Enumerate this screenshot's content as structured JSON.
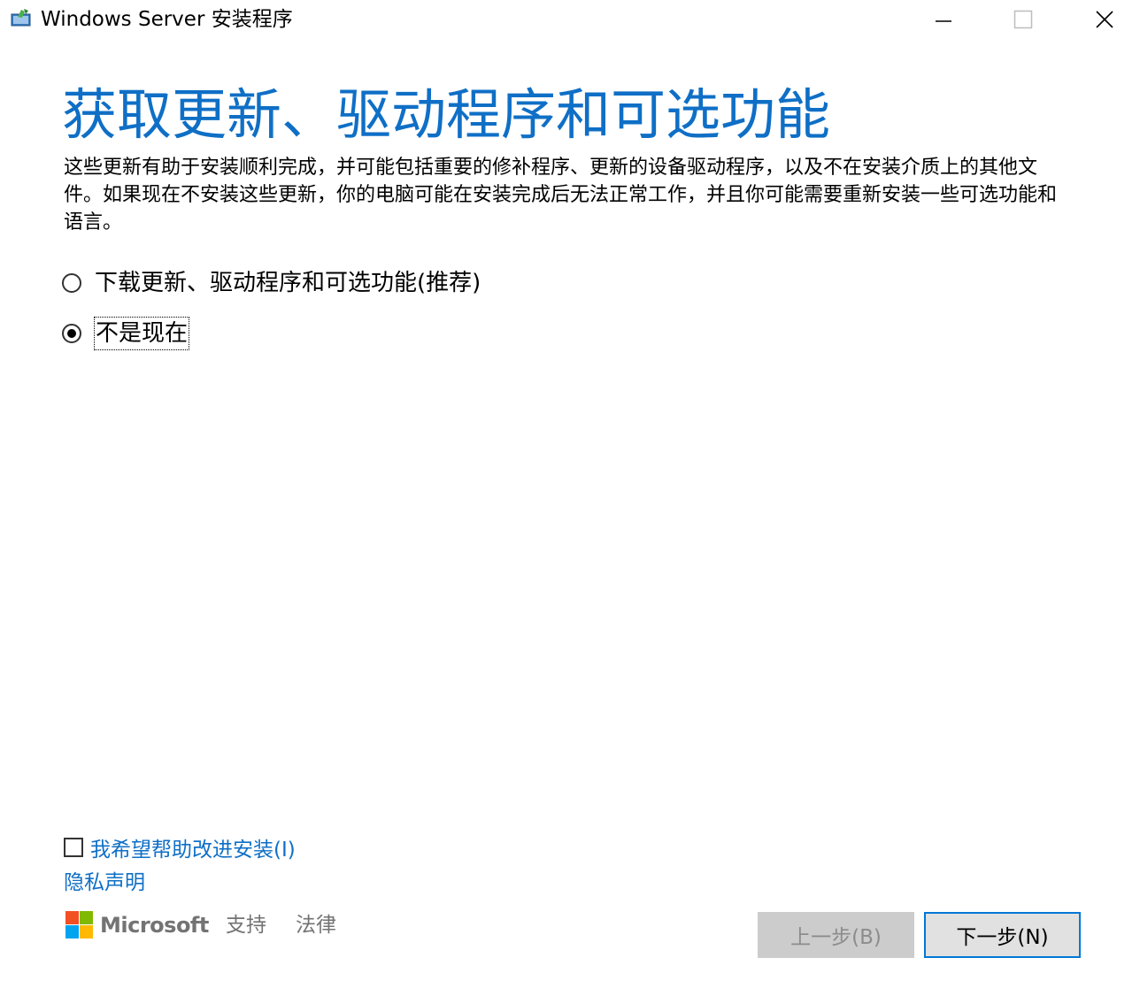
{
  "window": {
    "title": "Windows Server 安装程序",
    "controls": {
      "minimize_icon": "minimize-icon",
      "maximize_icon": "maximize-icon",
      "close_icon": "close-icon"
    }
  },
  "main": {
    "title": "获取更新、驱动程序和可选功能",
    "description": "这些更新有助于安装顺利完成，并可能包括重要的修补程序、更新的设备驱动程序，以及不在安装介质上的其他文件。如果现在不安装这些更新，你的电脑可能在安装完成后无法正常工作，并且你可能需要重新安装一些可选功能和语言。",
    "options": [
      {
        "label": "下载更新、驱动程序和可选功能(推荐)",
        "selected": false
      },
      {
        "label": "不是现在",
        "selected": true
      }
    ]
  },
  "footer": {
    "improve_label": "我希望帮助改进安装(I)",
    "improve_checked": false,
    "privacy_label": "隐私声明",
    "brand_name": "Microsoft",
    "support_label": "支持",
    "legal_label": "法律",
    "back_label": "上一步(B)",
    "next_label": "下一步(N)"
  },
  "colors": {
    "accent": "#0f6fc6",
    "button_border": "#0078d7",
    "ms_red": "#f25022",
    "ms_green": "#7fba00",
    "ms_blue": "#00a4ef",
    "ms_yellow": "#ffb900"
  }
}
